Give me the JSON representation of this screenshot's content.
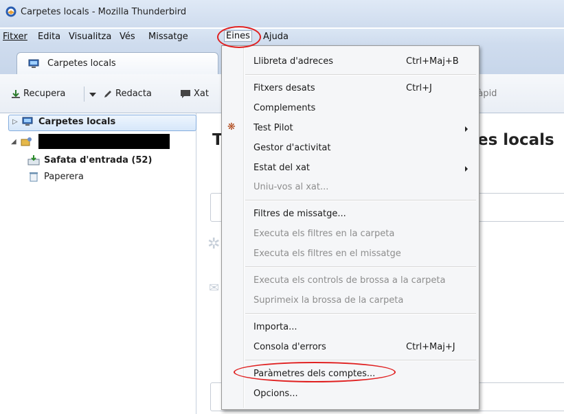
{
  "window": {
    "title": "Carpetes locals - Mozilla Thunderbird"
  },
  "menubar": {
    "items": [
      {
        "label": "Fitxer",
        "accesskey_index": 0
      },
      {
        "label": "Edita",
        "accesskey_index": 0
      },
      {
        "label": "Visualitza",
        "accesskey_index": 0
      },
      {
        "label": "Vés",
        "accesskey_index": 2
      },
      {
        "label": "Missatge",
        "accesskey_index": 0
      },
      {
        "label": "Eines",
        "accesskey_index": 1
      },
      {
        "label": "Ajuda",
        "accesskey_index": 1
      }
    ],
    "open_menu": "Eines"
  },
  "tabs": [
    {
      "label": "Carpetes locals",
      "active": true
    }
  ],
  "toolbar": {
    "get_label": "Recupera",
    "write_label": "Redacta",
    "chat_label": "Xat",
    "quickfilter_label": "ràpid"
  },
  "folders": {
    "root_label": "Carpetes locals",
    "inbox_label": "Safata d'entrada (52)",
    "trash_label": "Paperera"
  },
  "content": {
    "heading_start": "T",
    "heading_end": "tes locals"
  },
  "tools_menu": {
    "items": [
      {
        "label": "Llibreta d'adreces",
        "shortcut": "Ctrl+Maj+B",
        "disabled": false
      },
      {
        "label": "Fitxers desats",
        "shortcut": "Ctrl+J",
        "disabled": false
      },
      {
        "label": "Complements",
        "shortcut": "",
        "disabled": false
      },
      {
        "label": "Test Pilot",
        "shortcut": "",
        "disabled": false,
        "submenu": true
      },
      {
        "label": "Gestor d'activitat",
        "shortcut": "",
        "disabled": false
      },
      {
        "label": "Estat del xat",
        "shortcut": "",
        "disabled": false,
        "submenu": true
      },
      {
        "label": "Uniu-vos al xat...",
        "shortcut": "",
        "disabled": true
      },
      {
        "label": "Filtres de missatge...",
        "shortcut": "",
        "disabled": false
      },
      {
        "label": "Executa els filtres en la carpeta",
        "shortcut": "",
        "disabled": true
      },
      {
        "label": "Executa els filtres en el missatge",
        "shortcut": "",
        "disabled": true
      },
      {
        "label": "Executa els controls de brossa a la carpeta",
        "shortcut": "",
        "disabled": true
      },
      {
        "label": "Suprimeix la brossa de la carpeta",
        "shortcut": "",
        "disabled": true
      },
      {
        "label": "Importa...",
        "shortcut": "",
        "disabled": false
      },
      {
        "label": "Consola d'errors",
        "shortcut": "Ctrl+Maj+J",
        "disabled": false
      },
      {
        "label": "Paràmetres dels comptes...",
        "shortcut": "",
        "disabled": false
      },
      {
        "label": "Opcions...",
        "shortcut": "",
        "disabled": false
      }
    ]
  },
  "annotation_color": "#e02020"
}
